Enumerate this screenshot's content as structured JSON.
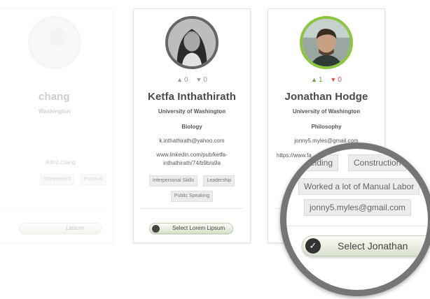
{
  "cards": [
    {
      "name": "Chang",
      "name_visible": "chang",
      "school": "Washington",
      "link": "/ktinz.chang",
      "tags": [
        "Independent",
        "Punctual"
      ],
      "button_label": "Lipsum"
    },
    {
      "name": "Ketfa Inthathirath",
      "school": "University of Washington",
      "major": "Biology",
      "email": "k.inthathirath@yahoo.com",
      "link": "www.linkedin.com/pub/ketfa-inthathirath/74/b9b/a9a",
      "votes_up": "0",
      "votes_down": "0",
      "tags": [
        "Interpersonal Skills",
        "Leadership",
        "Public Speaking"
      ],
      "button_label": "Select Lorem Lipsum"
    },
    {
      "name": "Jonathan Hodge",
      "school": "University of Washington",
      "major": "Philosophy",
      "email": "jonny5.myles@gmail.com",
      "link": "https://www.fa",
      "votes_up": "1",
      "votes_down": "0",
      "button_label": "Select Jonathan"
    }
  ],
  "magnifier": {
    "tags": [
      "elding",
      "Construction",
      "Worked a lot of Manual Labor",
      "jonny5.myles@gmail.com"
    ],
    "button_label": "Select Jonathan"
  },
  "icons": {
    "thumb_up": "thumbs-up-icon",
    "thumb_down": "thumbs-down-icon",
    "check": "check-icon"
  },
  "colors": {
    "accent_green": "#8cc63f",
    "upvote": "#63a635",
    "downvote": "#e34a4a",
    "magnifier_ring": "#767676"
  }
}
